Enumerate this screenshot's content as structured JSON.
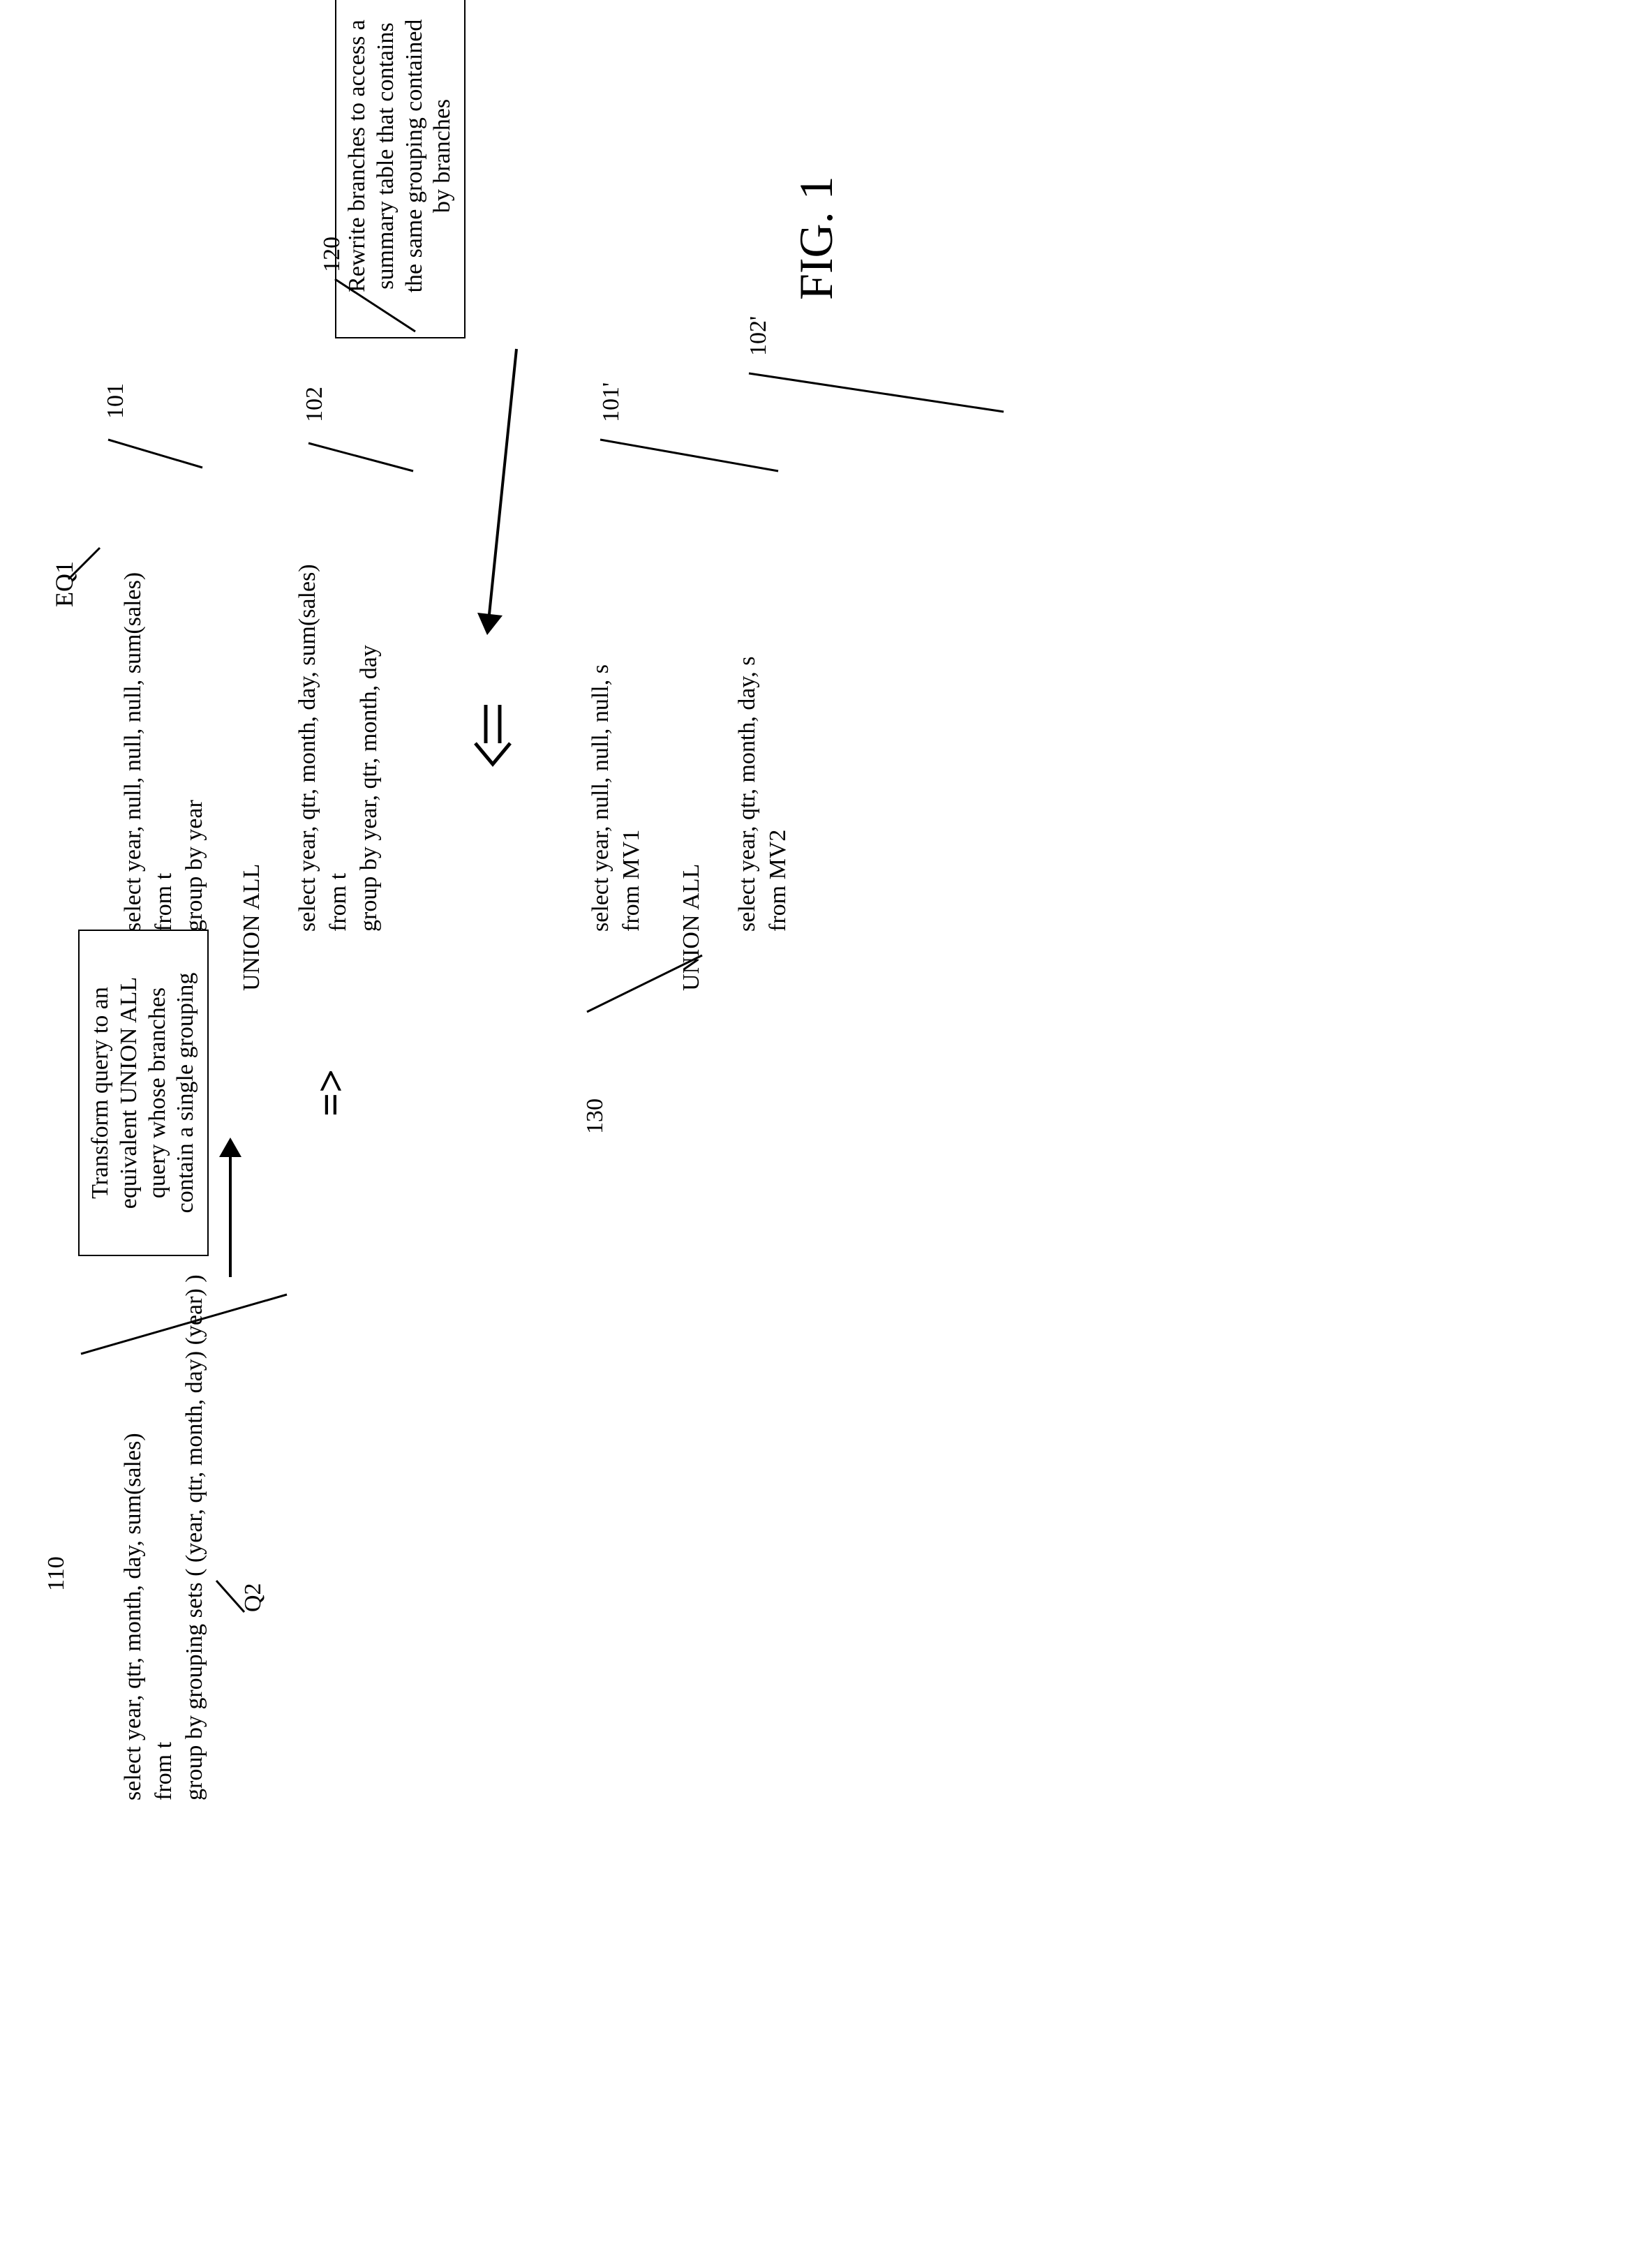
{
  "figure_label": "FIG. 1",
  "markers": {
    "q2": "Q2",
    "eq1": "EQ1",
    "m110": "110",
    "m120": "120",
    "m130": "130",
    "m101": "101",
    "m102": "102",
    "m101p": "101'",
    "m102p": "102'"
  },
  "box110": {
    "l1": "Transform query to an",
    "l2": "equivalent UNION ALL",
    "l3": "query whose branches",
    "l4": "contain a single grouping"
  },
  "box120": {
    "l1": "Rewrite branches to access a",
    "l2": "summary table that contains",
    "l3": "the same grouping contained",
    "l4": "by branches"
  },
  "arrow_glyph1": "=>",
  "arrow_glyph2": "",
  "query_q2": {
    "l1": "select year, qtr, month, day, sum(sales)",
    "l2": "from t",
    "l3": "group by grouping sets ( (year, qtr, month, day) (year) )"
  },
  "block101": {
    "l1": "select year, null, null, null, sum(sales)",
    "l2": "from t",
    "l3": "group by year"
  },
  "union_label": "UNION ALL",
  "block102": {
    "l1": "select year, qtr, month, day, sum(sales)",
    "l2": "from t",
    "l3": "group by year, qtr, month, day"
  },
  "block101p": {
    "l1": "select year, null, null, null, s",
    "l2": "from MV1"
  },
  "block102p": {
    "l1": "select year, qtr, month, day, s",
    "l2": "from MV2"
  }
}
